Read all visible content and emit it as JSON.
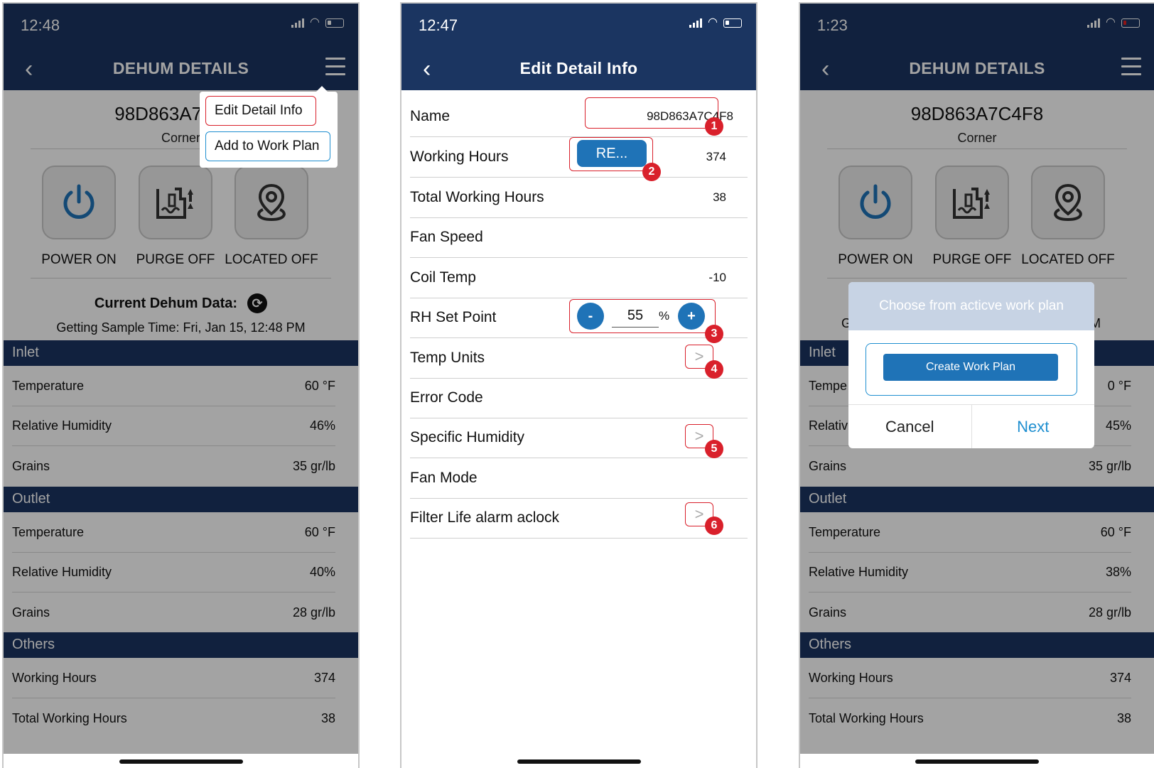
{
  "phone1": {
    "status": {
      "time": "12:48"
    },
    "nav": {
      "title": "DEHUM DETAILS"
    },
    "device": {
      "id": "98D863A7C4F8",
      "location": "Corner"
    },
    "controls": [
      {
        "label": "POWER ON",
        "icon": "power-icon"
      },
      {
        "label": "PURGE OFF",
        "icon": "purge-icon"
      },
      {
        "label": "LOCATED OFF",
        "icon": "location-pin-icon"
      }
    ],
    "current": {
      "heading": "Current Dehum Data:",
      "sample": "Getting Sample Time: Fri, Jan 15, 12:48 PM"
    },
    "sections": {
      "inlet": "Inlet",
      "outlet": "Outlet",
      "others": "Others"
    },
    "inlet": [
      {
        "label": "Temperature",
        "value": "60 °F"
      },
      {
        "label": "Relative Humidity",
        "value": "46%"
      },
      {
        "label": "Grains",
        "value": "35 gr/lb"
      }
    ],
    "outlet": [
      {
        "label": "Temperature",
        "value": "60 °F"
      },
      {
        "label": "Relative Humidity",
        "value": "40%"
      },
      {
        "label": "Grains",
        "value": "28 gr/lb"
      }
    ],
    "others": [
      {
        "label": "Working Hours",
        "value": "374"
      },
      {
        "label": "Total Working Hours",
        "value": "38"
      }
    ],
    "menu": {
      "edit": "Edit Detail Info",
      "add": "Add to Work Plan"
    }
  },
  "phone2": {
    "status": {
      "time": "12:47"
    },
    "nav": {
      "title": "Edit Detail Info"
    },
    "rows": [
      {
        "label": "Name",
        "value": "98D863A7C4F8"
      },
      {
        "label": "Working Hours",
        "value": "374",
        "button": "RE..."
      },
      {
        "label": "Total Working Hours",
        "value": "38"
      },
      {
        "label": "Fan Speed",
        "value": ""
      },
      {
        "label": "Coil Temp",
        "value": "-10"
      },
      {
        "label": "RH Set Point",
        "value": "55",
        "unit": "%",
        "minus": "-",
        "plus": "+"
      },
      {
        "label": "Temp Units",
        "value": ""
      },
      {
        "label": "Error Code",
        "value": ""
      },
      {
        "label": "Specific Humidity",
        "value": ""
      },
      {
        "label": "Fan Mode",
        "value": ""
      },
      {
        "label": "Filter Life alarm aclock",
        "value": ""
      }
    ],
    "badges": [
      "1",
      "2",
      "3",
      "4",
      "5",
      "6"
    ],
    "chevron": ">"
  },
  "phone3": {
    "status": {
      "time": "1:23"
    },
    "nav": {
      "title": "DEHUM DETAILS"
    },
    "device": {
      "id": "98D863A7C4F8",
      "location": "Corner"
    },
    "controls": [
      {
        "label": "POWER ON",
        "icon": "power-icon"
      },
      {
        "label": "PURGE OFF",
        "icon": "purge-icon"
      },
      {
        "label": "LOCATED OFF",
        "icon": "location-pin-icon"
      }
    ],
    "sections": {
      "inlet": "Inlet",
      "outlet": "Outlet",
      "others": "Others"
    },
    "inlet": [
      {
        "label": "Tempe",
        "value": "0 °F"
      },
      {
        "label": "Relativ",
        "value": "45%"
      },
      {
        "label": "Grains",
        "value": "35 gr/lb"
      }
    ],
    "outlet": [
      {
        "label": "Temperature",
        "value": "60 °F"
      },
      {
        "label": "Relative Humidity",
        "value": "38%"
      },
      {
        "label": "Grains",
        "value": "28 gr/lb"
      }
    ],
    "others": [
      {
        "label": "Working Hours",
        "value": "374"
      },
      {
        "label": "Total Working Hours",
        "value": "38"
      }
    ],
    "peek_left": "G",
    "peek_right": "M",
    "dialog": {
      "title": "Choose from acticve work plan",
      "create": "Create Work Plan",
      "cancel": "Cancel",
      "next": "Next"
    }
  },
  "colors": {
    "navy": "#1b3561",
    "blue": "#1f73b7",
    "highlight_red": "#d9202b",
    "highlight_blue": "#1f8fd0"
  }
}
